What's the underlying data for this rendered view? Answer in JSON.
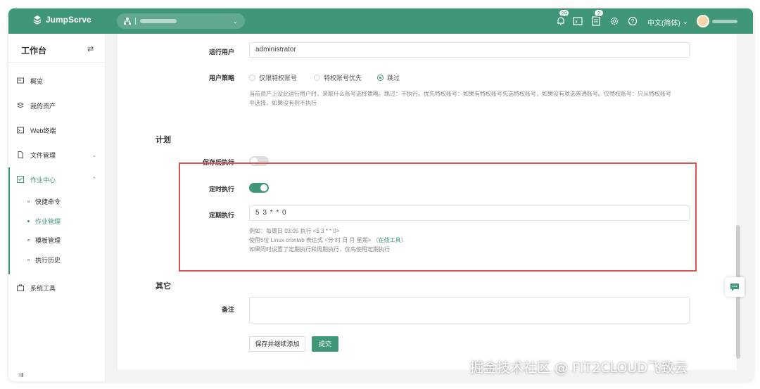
{
  "app": {
    "name": "JumpServe",
    "brand_color": "#3f9775"
  },
  "topbar": {
    "org_icon": "org-icon",
    "notification_count": "29",
    "ticket_count": "2",
    "language": "中文(简体)"
  },
  "sidebar": {
    "title": "工作台",
    "items": [
      {
        "label": "概览",
        "icon": "overview-icon"
      },
      {
        "label": "我的资产",
        "icon": "assets-icon"
      },
      {
        "label": "Web终端",
        "icon": "terminal-icon"
      },
      {
        "label": "文件管理",
        "icon": "file-icon"
      },
      {
        "label": "作业中心",
        "icon": "job-icon"
      },
      {
        "label": "系统工具",
        "icon": "tools-icon"
      }
    ],
    "subitems": [
      {
        "label": "快捷命令"
      },
      {
        "label": "作业管理"
      },
      {
        "label": "模板管理"
      },
      {
        "label": "执行历史"
      }
    ]
  },
  "form": {
    "run_user_label": "运行用户",
    "run_user_value": "administrator",
    "user_policy_label": "用户策略",
    "policy_options": [
      "仅限特权账号",
      "特权账号优先",
      "跳过"
    ],
    "policy_selected": "跳过",
    "policy_help_line1": "当前资产上没此运行用户时，采取什么账号选择策略。跳过：不执行。优先特权账号：如果有特权账号先选特权账号，如果没有就选普通账号。仅特权账号：只从特权账号",
    "policy_help_line2": "中选择，如果没有则不执行",
    "plan_section": "计划",
    "run_after_save_label": "保存后执行",
    "run_after_save": false,
    "scheduled_label": "定时执行",
    "scheduled": true,
    "periodic_label": "定期执行",
    "periodic_value": "5 3 * * 0",
    "cron_help_line1": "例如：每周日 03:05 执行 <5 3 * * 0>",
    "cron_help_line2": "使用5位 Linux crontab 表达式 <分 时 日 月 星期> （",
    "cron_help_link": "在线工具",
    "cron_help_line2_end": "）",
    "cron_help_line3": "如果同时设置了定期执行和周期执行，优先使用定期执行",
    "other_section": "其它",
    "comment_label": "备注",
    "comment_value": "",
    "save_continue_button": "保存并继续添加",
    "submit_button": "提交"
  },
  "watermark": "掘金技术社区 @ FIT2CLOUD飞致云"
}
